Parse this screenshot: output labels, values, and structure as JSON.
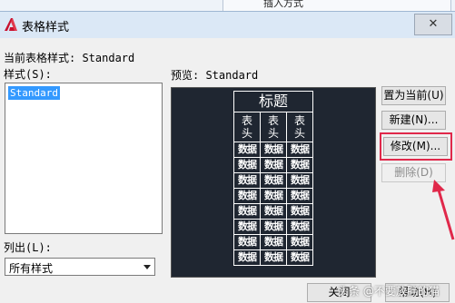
{
  "background_window": {
    "menu_text": "插入方式"
  },
  "dialog": {
    "title": "表格样式",
    "close_label": "✕",
    "current_style_label": "当前表格样式: Standard",
    "styles_label": "样式(S):",
    "styles": [
      "Standard"
    ],
    "preview_label": "预览: Standard",
    "list_label": "列出(L):",
    "list_selected": "所有样式",
    "preview_table": {
      "title": "标题",
      "headers": [
        "表\n头",
        "表\n头",
        "表\n头"
      ],
      "data_cell": "数据",
      "data_rows": 8
    },
    "buttons": {
      "set_current": "置为当前(U)",
      "new": "新建(N)...",
      "modify": "修改(M)...",
      "delete": "删除(D)",
      "close": "关闭",
      "help": "帮助(H)"
    }
  },
  "watermark": "头条 @不要放胖的猫",
  "colors": {
    "highlight": "#e0284a",
    "selection": "#3399ff",
    "preview_bg": "#1f2631"
  }
}
